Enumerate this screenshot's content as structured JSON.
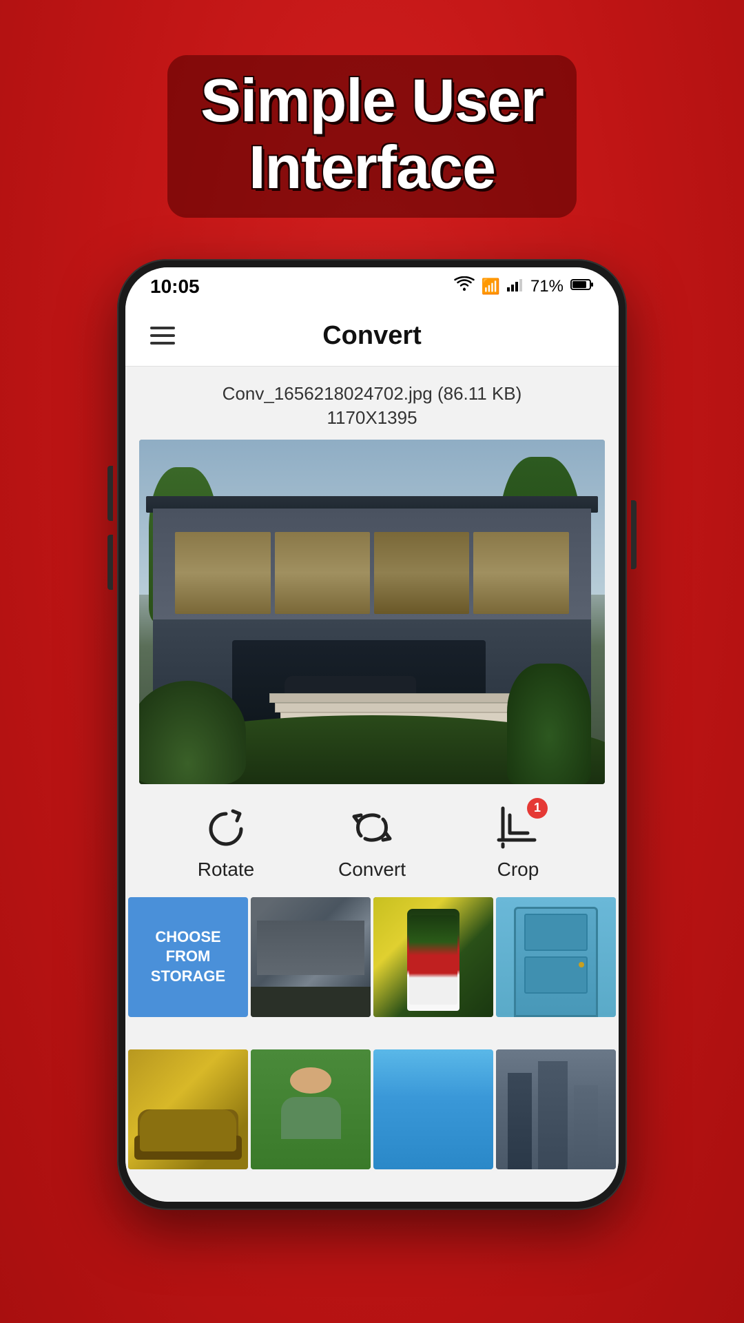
{
  "background": {
    "color": "#cc1a1a"
  },
  "headline": {
    "text": "Simple User Interface",
    "line1": "Simple User",
    "line2": "Interface"
  },
  "phone": {
    "status_bar": {
      "time": "10:05",
      "battery": "71%",
      "signal_bars": "▂▄▆",
      "wifi_icon": "wifi"
    },
    "app_bar": {
      "title": "Convert",
      "menu_icon": "hamburger"
    },
    "file_info": {
      "filename": "Conv_1656218024702.jpg (86.11 KB)",
      "dimensions": "1170X1395"
    },
    "action_buttons": [
      {
        "id": "rotate",
        "label": "Rotate",
        "icon": "rotate-icon",
        "badge": null
      },
      {
        "id": "convert",
        "label": "Convert",
        "icon": "convert-icon",
        "badge": null
      },
      {
        "id": "crop",
        "label": "Crop",
        "icon": "crop-icon",
        "badge": "1"
      }
    ],
    "gallery": {
      "choose_label_line1": "CHOOSE",
      "choose_label_line2": "FROM",
      "choose_label_line3": "STORAGE",
      "items": [
        {
          "id": "choose",
          "type": "choose"
        },
        {
          "id": "house2",
          "type": "house2"
        },
        {
          "id": "bottle",
          "type": "bottle"
        },
        {
          "id": "door",
          "type": "door"
        },
        {
          "id": "car",
          "type": "car"
        },
        {
          "id": "person",
          "type": "person"
        },
        {
          "id": "blue",
          "type": "blue"
        },
        {
          "id": "building2",
          "type": "building2"
        }
      ]
    }
  }
}
